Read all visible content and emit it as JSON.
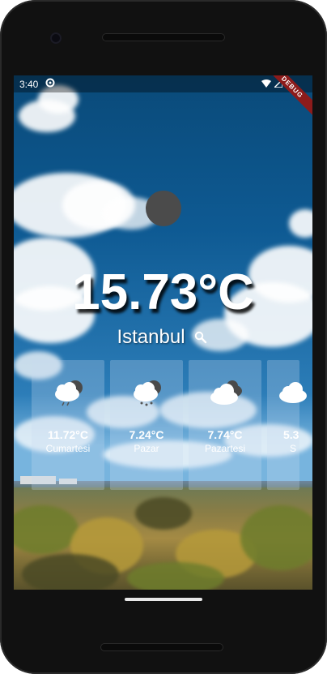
{
  "status_bar": {
    "time": "3:40",
    "debug_label": "DEBUG"
  },
  "weather": {
    "current_temp": "15.73°C",
    "city": "Istanbul"
  },
  "forecast": [
    {
      "temp": "11.72°C",
      "day": "Cumartesi",
      "icon": "cloud-sun-rain-icon"
    },
    {
      "temp": "7.24°C",
      "day": "Pazar",
      "icon": "cloud-sun-snow-icon"
    },
    {
      "temp": "7.74°C",
      "day": "Pazartesi",
      "icon": "cloudy-icon"
    },
    {
      "temp": "5.3",
      "day": "S",
      "icon": "cloud-icon"
    }
  ],
  "colors": {
    "sky": "#0e5a93",
    "debug_ribbon": "#8c1b1b",
    "avatar": "#4b4b4b"
  }
}
